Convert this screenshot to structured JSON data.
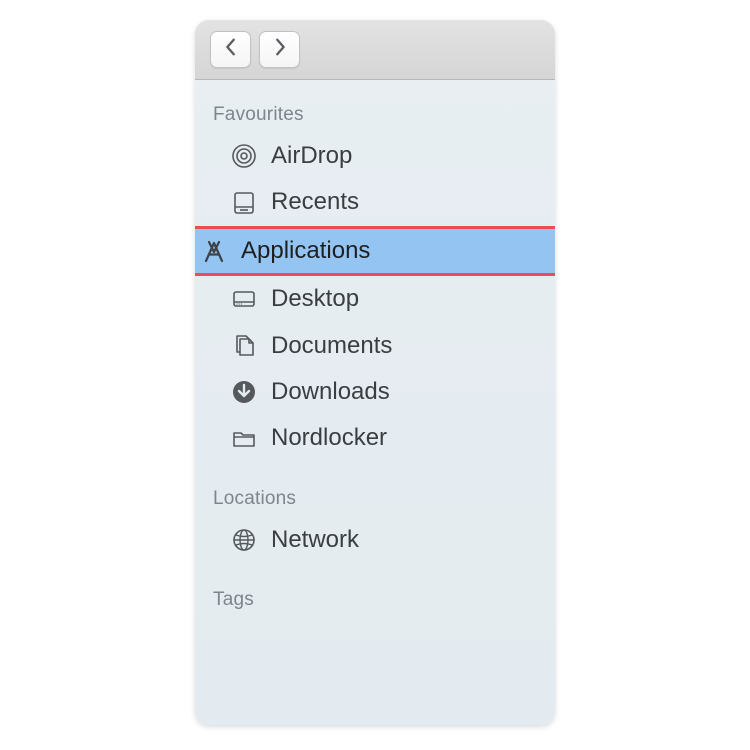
{
  "sections": {
    "favourites": {
      "header": "Favourites",
      "items": {
        "airdrop": "AirDrop",
        "recents": "Recents",
        "applications": "Applications",
        "desktop": "Desktop",
        "documents": "Documents",
        "downloads": "Downloads",
        "nordlocker": "Nordlocker"
      }
    },
    "locations": {
      "header": "Locations",
      "items": {
        "network": "Network"
      }
    },
    "tags": {
      "header": "Tags"
    }
  },
  "colors": {
    "highlight_bg": "#94c5f2",
    "highlight_border": "#ef4b55",
    "text": "#3a3e42",
    "header_text": "#7d868d"
  }
}
